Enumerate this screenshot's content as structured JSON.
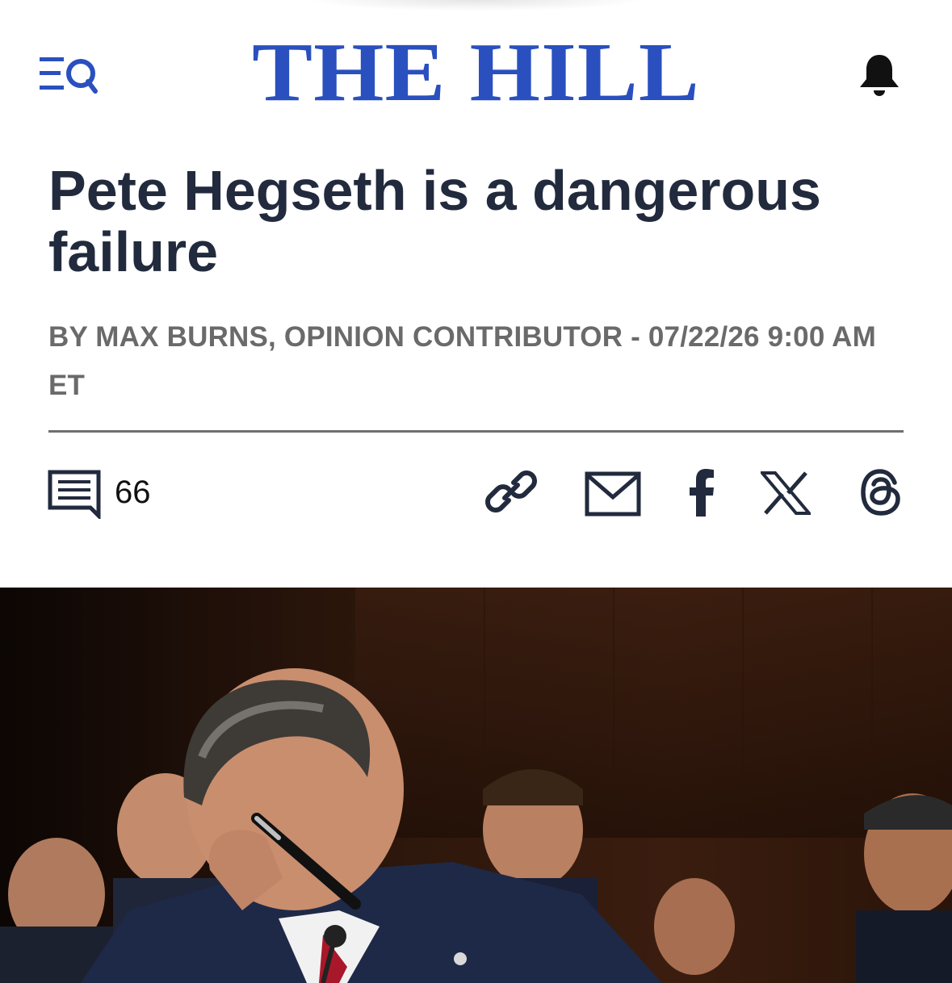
{
  "header": {
    "logo_text": "THE HILL",
    "brand_color": "#2a50bf"
  },
  "article": {
    "headline": "Pete Hegseth is a dangerous failure",
    "byline": "BY MAX BURNS, OPINION CONTRIBUTOR - 07/22/26 9:00 AM ET",
    "comment_count": "66"
  },
  "icons": {
    "menu": "menu-search-icon",
    "notifications": "bell-icon",
    "comments": "comment-icon",
    "share": [
      "link-icon",
      "mail-icon",
      "facebook-icon",
      "x-icon",
      "threads-icon"
    ]
  },
  "colors": {
    "headline": "#222a3d",
    "byline": "#6a6a6a",
    "icons": "#222a3d"
  }
}
